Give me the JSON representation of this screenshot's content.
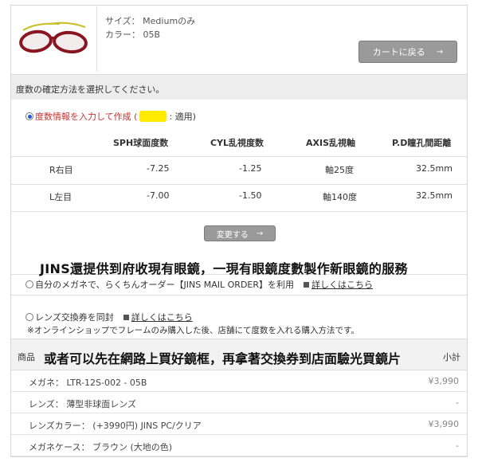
{
  "product": {
    "size_label": "サイズ：",
    "size_value": "Mediumのみ",
    "color_label": "カラー：",
    "color_value": "05B",
    "back_button": "カートに戻る",
    "back_arrow": "→"
  },
  "section_title": "度数の確定方法を選択してください。",
  "option_manual": {
    "label": "度数情報を入力して作成 (",
    "suffix": ": 適用)"
  },
  "table": {
    "headers": [
      "SPH球面度数",
      "CYL乱視度数",
      "AXIS乱視軸",
      "P.D瞳孔間距離"
    ],
    "rows": [
      {
        "eye": "R右目",
        "sph": "-7.25",
        "cyl": "-1.25",
        "axis": "軸25度",
        "pd": "32.5mm"
      },
      {
        "eye": "L左目",
        "sph": "-7.00",
        "cyl": "-1.50",
        "axis": "軸140度",
        "pd": "32.5mm"
      }
    ]
  },
  "change_button": "変更する",
  "change_arrow": "→",
  "overlay_caption_1": "JINS還提供到府收現有眼鏡，一現有眼鏡度數製作新眼鏡的服務",
  "option_mail": {
    "label": "自分のメガネで、らくちんオーダー【JINS MAIL ORDER】を利用",
    "link": "詳しくはこちら"
  },
  "option_coupon": {
    "label": "レンズ交換券を同封",
    "link": "詳しくはこちら",
    "note": "※オンラインショップでフレームのみ購入した後、店舗にて度数を入れる購入方法です。"
  },
  "summary": {
    "col_left": "商品",
    "col_right": "小計",
    "overlay_caption_2": "或者可以先在網路上買好鏡框，再拿著交換券到店面驗光買鏡片",
    "items": [
      {
        "label": "メガネ： LTR-12S-002 - 05B",
        "value": "¥3,990"
      },
      {
        "label": "レンズ： 薄型非球面レンズ",
        "value": "-"
      },
      {
        "label": "レンズカラー： (+3990円) JINS PC/クリア",
        "value": "¥3,990"
      },
      {
        "label": "メガネケース： ブラウン (大地の色)",
        "value": "-"
      }
    ]
  }
}
